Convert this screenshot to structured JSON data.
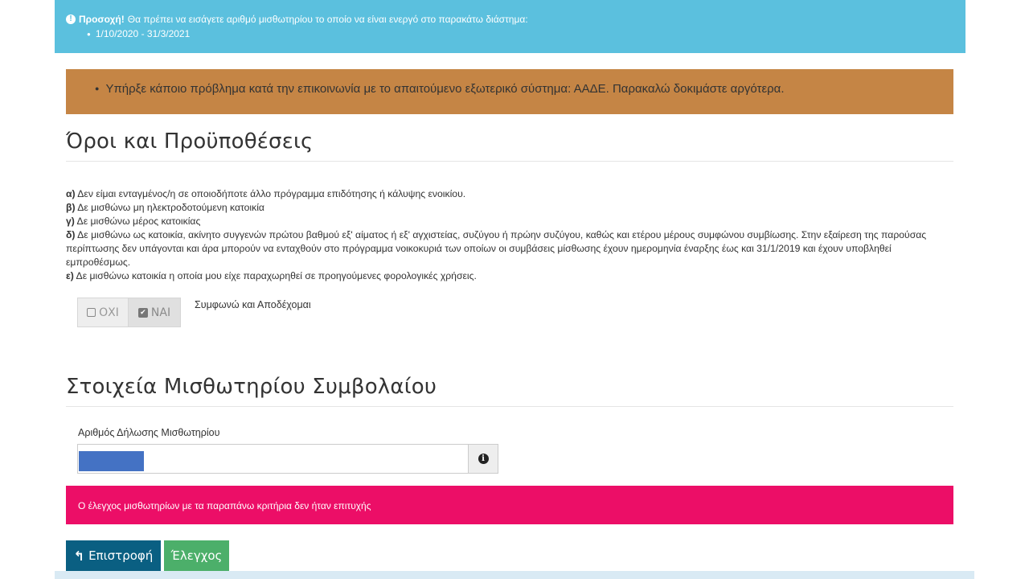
{
  "info_banner": {
    "icon": "exclamation-circle-icon",
    "bold_label": "Προσοχή!",
    "message": "Θα πρέπει να εισάγετε αριθμό μισθωτηρίου το οποίο να είναι ενεργό στο παρακάτω διάστημα:",
    "date_range": "1/10/2020 - 31/3/2021",
    "color": "#5bc0de"
  },
  "warning_banner": {
    "message": "Υπήρξε κάποιο πρόβλημα κατά την επικοινωνία με το απαιτούμενο εξωτερικό σύστημα: ΑΑΔΕ. Παρακαλώ δοκιμάστε αργότερα.",
    "color": "#c58545"
  },
  "terms_section": {
    "title": "Όροι και Προϋποθέσεις",
    "items": [
      {
        "marker": "α)",
        "text": " Δεν είμαι ενταγμένος/η σε οποιοδήποτε άλλο πρόγραμμα επιδότησης ή κάλυψης ενοικίου."
      },
      {
        "marker": "β)",
        "text": " Δε μισθώνω μη ηλεκτροδοτούμενη κατοικία"
      },
      {
        "marker": "γ)",
        "text": " Δε μισθώνω μέρος κατοικίας"
      },
      {
        "marker": "δ)",
        "text": " Δε μισθώνω ως κατοικία, ακίνητο συγγενών πρώτου βαθμού εξ' αίματος ή εξ' αγχιστείας, συζύγου ή πρώην συζύγου, καθώς και ετέρου μέρους συμφώνου συμβίωσης. Στην εξαίρεση της παρούσας περίπτωσης δεν υπάγονται και άρα μπορούν να ενταχθούν στο πρόγραμμα νοικοκυριά των οποίων οι συμβάσεις μίσθωσης έχουν ημερομηνία έναρξης έως και 31/1/2019 και έχουν υποβληθεί εμπροθέσμως."
      },
      {
        "marker": "ε)",
        "text": " Δε μισθώνω κατοικία η οποία μου είχε παραχωρηθεί σε προηγούμενες φορολογικές χρήσεις."
      }
    ],
    "option_no": "ΟΧΙ",
    "option_yes": "ΝΑΙ",
    "selected": "ΝΑΙ",
    "agree_label": "Συμφωνώ και Αποδέχομαι"
  },
  "lease_section": {
    "title": "Στοιχεία Μισθωτηρίου Συμβολαίου",
    "field_label": "Αριθμός Δήλωσης Μισθωτηρίου",
    "input_value": "",
    "addon_icon": "info-circle-icon"
  },
  "error_banner": {
    "message": "Ο έλεγχος μισθωτηρίων με τα παραπάνω κριτήρια δεν ήταν επιτυχής",
    "color": "#ec0e67"
  },
  "actions": {
    "back_label": "Επιστροφή",
    "back_icon": "reply-icon",
    "check_label": "Έλεγχος"
  }
}
